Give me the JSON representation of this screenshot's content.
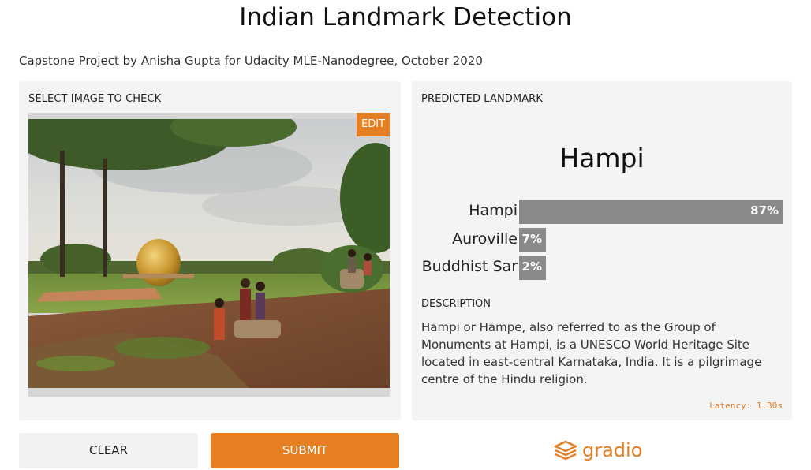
{
  "header": {
    "title": "Indian Landmark Detection",
    "subtitle": "Capstone Project by Anisha Gupta for Udacity MLE-Nanodegree, October 2020"
  },
  "input_panel": {
    "label": "SELECT IMAGE TO CHECK",
    "edit_label": "EDIT"
  },
  "output_panel": {
    "label": "PREDICTED LANDMARK",
    "prediction": "Hampi",
    "confidences": [
      {
        "name": "Hampi",
        "pct_label": "87%",
        "value": 0.87
      },
      {
        "name": "Auroville",
        "pct_label": "7%",
        "value": 0.07
      },
      {
        "name": "Buddhist Sar",
        "pct_label": "2%",
        "value": 0.02
      }
    ],
    "description_label": "DESCRIPTION",
    "description": "Hampi or Hampe, also referred to as the Group of Monuments at Hampi, is a UNESCO World Heritage Site located in east-central Karnataka, India. It is a pilgrimage centre of the Hindu religion.",
    "latency": "Latency: 1.30s"
  },
  "actions": {
    "clear_label": "CLEAR",
    "submit_label": "SUBMIT"
  },
  "footer": {
    "brand": "gradio"
  },
  "colors": {
    "accent": "#e67e22",
    "bar": "#8a8a8a",
    "panel": "#f4f4f4"
  },
  "icons": {
    "brand_logo": "gradio-logo-icon"
  }
}
